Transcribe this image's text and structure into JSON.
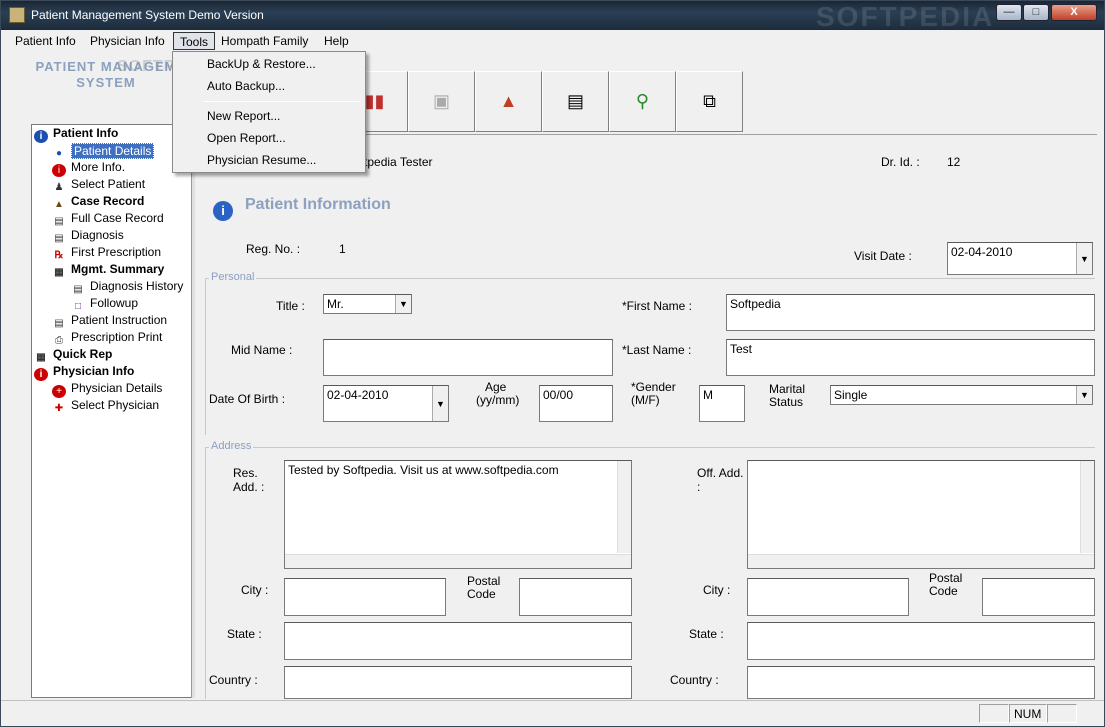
{
  "window": {
    "title": "Patient Management System Demo Version",
    "watermark": "SOFTPEDIA"
  },
  "menubar": {
    "items": [
      "Patient Info",
      "Physician Info",
      "Tools",
      "Hompath Family",
      "Help"
    ],
    "active": "Tools"
  },
  "tools_menu": {
    "items": [
      "BackUp & Restore...",
      "Auto Backup...",
      "New Report...",
      "Open Report...",
      "Physician Resume..."
    ]
  },
  "logo": {
    "line1": "PATIENT MANAGEM",
    "line2": "SYSTEM",
    "watermark": "SOFTPEDIA"
  },
  "tree": {
    "items": [
      {
        "label": "Patient Info",
        "icon": "info-icon"
      },
      {
        "label": "Patient Details",
        "icon": "person-icon"
      },
      {
        "label": "More Info.",
        "icon": "info-small-icon"
      },
      {
        "label": "Select Patient",
        "icon": "group-icon"
      },
      {
        "label": "Case Record",
        "icon": "briefcase-icon"
      },
      {
        "label": "Full Case Record",
        "icon": "record-icon"
      },
      {
        "label": "Diagnosis",
        "icon": "diagnosis-icon"
      },
      {
        "label": "First Prescription",
        "icon": "rx-icon"
      },
      {
        "label": "Mgmt. Summary",
        "icon": "summary-icon"
      },
      {
        "label": "Diagnosis History",
        "icon": "history-icon"
      },
      {
        "label": "Followup",
        "icon": "followup-icon"
      },
      {
        "label": "Patient Instruction",
        "icon": "instruction-icon"
      },
      {
        "label": "Prescription Print",
        "icon": "printer-icon"
      },
      {
        "label": "Quick Rep",
        "icon": "report-icon"
      },
      {
        "label": "Physician Info",
        "icon": "physician-icon"
      },
      {
        "label": "Physician Details",
        "icon": "cross-icon"
      },
      {
        "label": "Select Physician",
        "icon": "select-physician-icon"
      }
    ]
  },
  "header": {
    "user": "Softpedia Tester",
    "user_visible": "oftpedia Tester",
    "dr_id_label": "Dr. Id. :",
    "dr_id": "12"
  },
  "section": {
    "title": "Patient Information"
  },
  "form": {
    "reg_no_label": "Reg. No. :",
    "reg_no": "1",
    "visit_date_label": "Visit Date :",
    "visit_date": "02-04-2010",
    "personal_group": "Personal",
    "title_label": "Title :",
    "title_value": "Mr.",
    "first_name_label": "*First Name :",
    "first_name": "Softpedia",
    "mid_name_label": "Mid Name :",
    "mid_name": "",
    "last_name_label": "*Last Name :",
    "last_name": "Test",
    "dob_label": "Date Of Birth :",
    "dob": "02-04-2010",
    "age_label_1": "Age",
    "age_label_2": "(yy/mm)",
    "age": "00/00",
    "gender_label_1": "*Gender",
    "gender_label_2": "(M/F)",
    "gender": "M",
    "marital_label_1": "Marital",
    "marital_label_2": "Status",
    "marital": "Single",
    "address_group": "Address",
    "res_add_label_1": "Res.",
    "res_add_label_2": "Add. :",
    "res_add": "Tested by Softpedia. Visit us at www.softpedia.com",
    "off_add_label_1": "Off. Add.",
    "off_add_label_2": ":",
    "off_add": "",
    "city_label": "City :",
    "postal_label_1": "Postal",
    "postal_label_2": "Code",
    "state_label": "State :",
    "country_label": "Country :"
  },
  "statusbar": {
    "num": "NUM"
  }
}
